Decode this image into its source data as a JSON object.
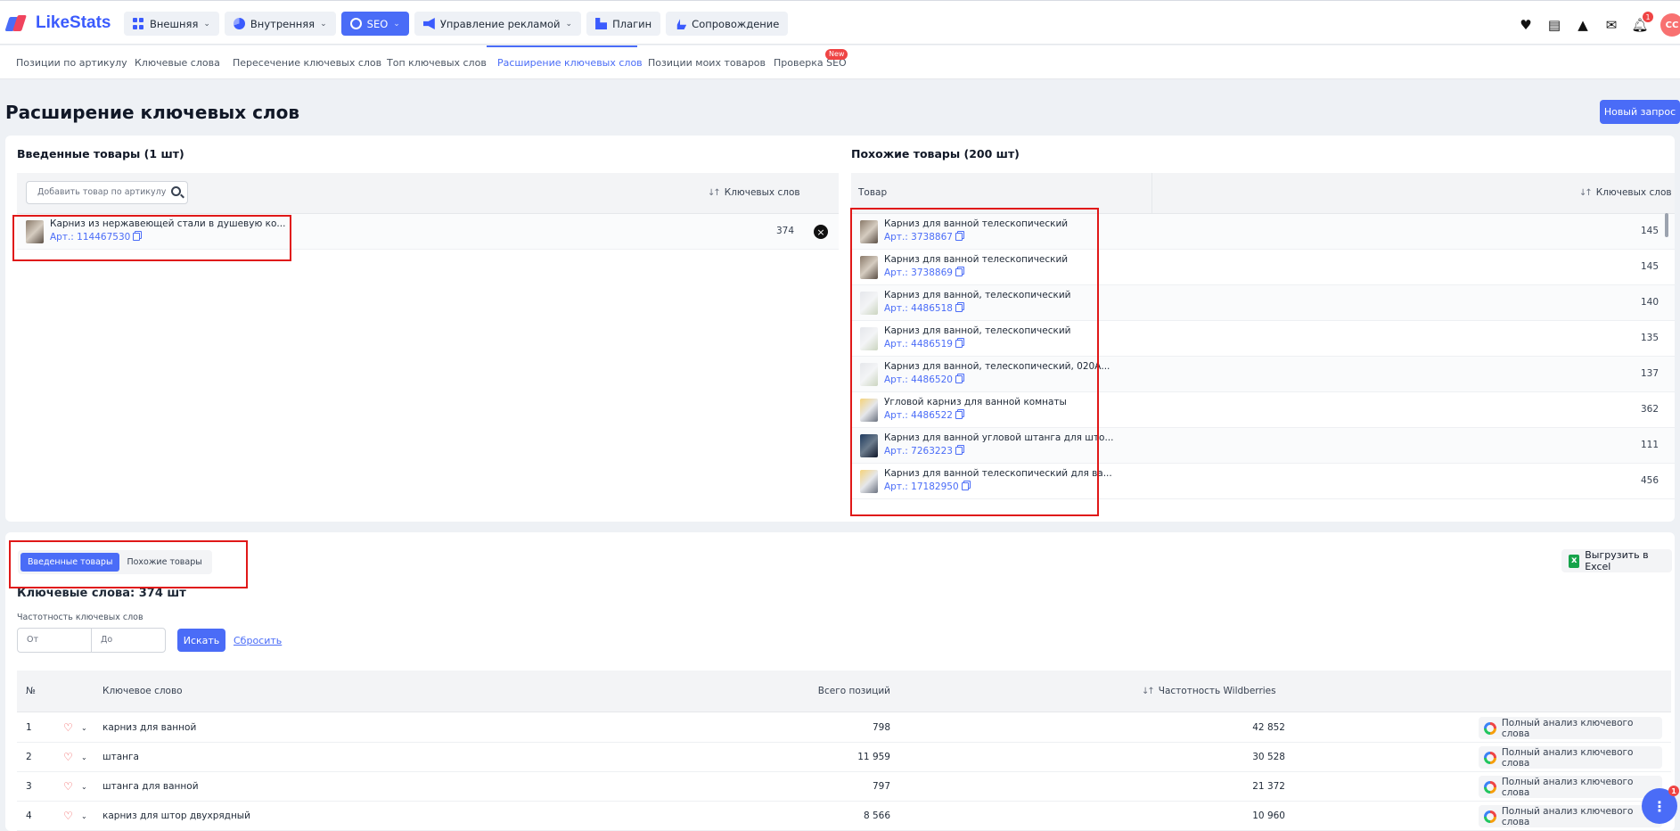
{
  "app": {
    "name": "LikeStats"
  },
  "nav": [
    {
      "label": "Внешняя",
      "icon": "grid-icon",
      "dropdown": true,
      "active": false
    },
    {
      "label": "Внутренняя",
      "icon": "pie-chart-icon",
      "dropdown": true,
      "active": false
    },
    {
      "label": "SEO",
      "icon": "chat-icon",
      "dropdown": true,
      "active": true
    },
    {
      "label": "Управление рекламой",
      "icon": "megaphone-icon",
      "dropdown": true,
      "active": false
    },
    {
      "label": "Плагин",
      "icon": "plugin-icon",
      "dropdown": false,
      "active": false
    },
    {
      "label": "Сопровождение",
      "icon": "ship-icon",
      "dropdown": false,
      "active": false
    }
  ],
  "header_right": {
    "notifications_count": "1",
    "avatar_initials": "СС"
  },
  "subnav": [
    {
      "label": "Позиции по артикулу"
    },
    {
      "label": "Ключевые слова"
    },
    {
      "label": "Пересечение ключевых слов"
    },
    {
      "label": "Топ ключевых слов"
    },
    {
      "label": "Расширение ключевых слов"
    },
    {
      "label": "Позиции моих товаров"
    },
    {
      "label": "Проверка SEO"
    }
  ],
  "subnav_new_badge": "New",
  "page": {
    "title": "Расширение ключевых слов",
    "new_request": "Новый запрос"
  },
  "entered": {
    "title": "Введенные товары (1 шт)",
    "search_placeholder": "Добавить товар по артикулу",
    "col_keywords": "Ключевых слов",
    "items": [
      {
        "name": "Карниз из нержавеющей стали в душевую ко...",
        "art": "Арт.: 114467530",
        "keywords": "374"
      }
    ]
  },
  "similar": {
    "title": "Похожие товары (200 шт)",
    "col_product": "Товар",
    "col_keywords": "Ключевых слов",
    "items": [
      {
        "name": "Карниз для ванной телескопический",
        "art": "Арт.: 3738867",
        "keywords": "145"
      },
      {
        "name": "Карниз для ванной телескопический",
        "art": "Арт.: 3738869",
        "keywords": "145"
      },
      {
        "name": "Карниз для ванной, телескопический",
        "art": "Арт.: 4486518",
        "keywords": "140"
      },
      {
        "name": "Карниз для ванной, телескопический",
        "art": "Арт.: 4486519",
        "keywords": "135"
      },
      {
        "name": "Карниз для ванной, телескопический, 020А...",
        "art": "Арт.: 4486520",
        "keywords": "137"
      },
      {
        "name": "Угловой карниз для ванной комнаты",
        "art": "Арт.: 4486522",
        "keywords": "362"
      },
      {
        "name": "Карниз для ванной угловой штанга для што...",
        "art": "Арт.: 7263223",
        "keywords": "111"
      },
      {
        "name": "Карниз для ванной телескопический для ва...",
        "art": "Арт.: 17182950",
        "keywords": "456"
      }
    ]
  },
  "toggle": {
    "entered": "Введенные товары",
    "similar": "Похожие товары"
  },
  "export": {
    "label": "Выгрузить в Excel"
  },
  "keywords": {
    "title": "Ключевые слова: 374 шт",
    "freq_label": "Частотность ключевых слов",
    "from_placeholder": "От",
    "to_placeholder": "До",
    "search": "Искать",
    "reset": "Сбросить",
    "columns": {
      "num": "№",
      "keyword": "Ключевое слово",
      "positions": "Всего позиций",
      "frequency": "Частотность Wildberries"
    },
    "analysis_label": "Полный анализ ключевого слова",
    "rows": [
      {
        "n": "1",
        "keyword": "карниз для ванной",
        "positions": "798",
        "frequency": "42 852"
      },
      {
        "n": "2",
        "keyword": "штанга",
        "positions": "11 959",
        "frequency": "30 528"
      },
      {
        "n": "3",
        "keyword": "штанга для ванной",
        "positions": "797",
        "frequency": "21 372"
      },
      {
        "n": "4",
        "keyword": "карниз для штор двухрядный",
        "positions": "8 566",
        "frequency": "10 960"
      }
    ]
  },
  "help": {
    "badge": "1"
  }
}
